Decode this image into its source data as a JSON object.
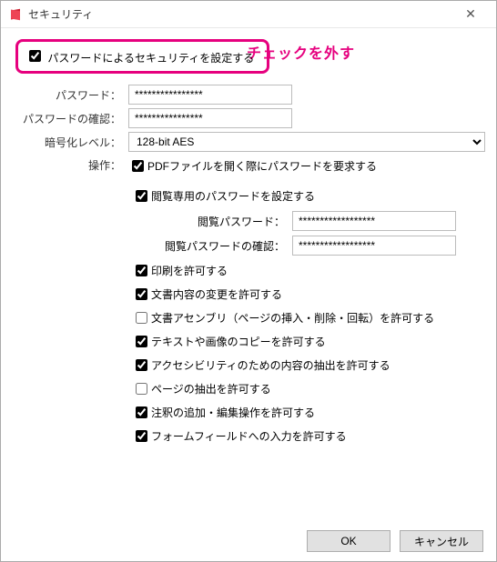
{
  "window": {
    "title": "セキュリティ"
  },
  "main_toggle": {
    "label": "パスワードによるセキュリティを設定する",
    "checked": true
  },
  "callout_text": "チェックを外す",
  "fields": {
    "password_label": "パスワード：",
    "password_value": "****************",
    "confirm_label": "パスワードの確認：",
    "confirm_value": "****************",
    "encrypt_label": "暗号化レベル：",
    "encrypt_value": "128-bit AES",
    "ops_label": "操作："
  },
  "ops": {
    "op1": {
      "label": "PDFファイルを開く際にパスワードを要求する",
      "checked": true
    },
    "op2": {
      "label": "閲覧専用のパスワードを設定する",
      "checked": true
    },
    "view_pw_label": "閲覧パスワード：",
    "view_pw_value": "******************",
    "view_pw_confirm_label": "閲覧パスワードの確認：",
    "view_pw_confirm_value": "******************",
    "op3": {
      "label": "印刷を許可する",
      "checked": true
    },
    "op4": {
      "label": "文書内容の変更を許可する",
      "checked": true
    },
    "op5": {
      "label": "文書アセンブリ（ページの挿入・削除・回転）を許可する",
      "checked": false
    },
    "op6": {
      "label": "テキストや画像のコピーを許可する",
      "checked": true
    },
    "op7": {
      "label": "アクセシビリティのための内容の抽出を許可する",
      "checked": true
    },
    "op8": {
      "label": "ページの抽出を許可する",
      "checked": false
    },
    "op9": {
      "label": "注釈の追加・編集操作を許可する",
      "checked": true
    },
    "op10": {
      "label": "フォームフィールドへの入力を許可する",
      "checked": true
    }
  },
  "buttons": {
    "ok": "OK",
    "cancel": "キャンセル"
  }
}
